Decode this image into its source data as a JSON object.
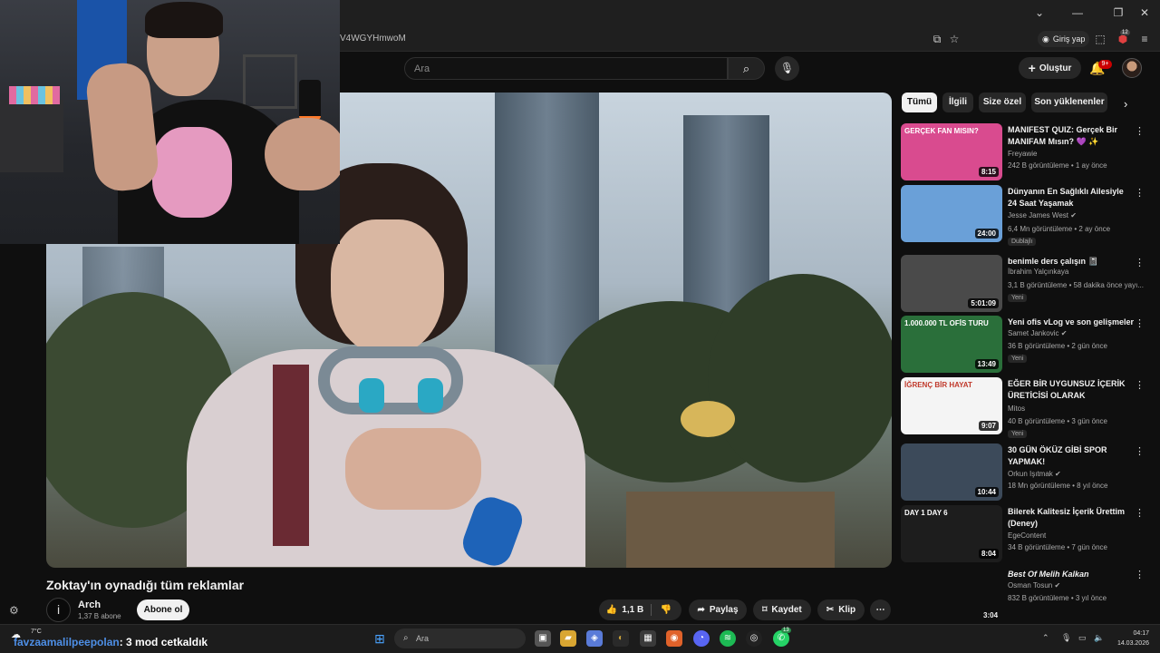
{
  "browser": {
    "url": "V4WGYHmwoM",
    "signin_label": "Giriş yap",
    "ext_badge": "12"
  },
  "youtube": {
    "search_placeholder": "Ara",
    "create_label": "Oluştur",
    "notif_badge": "9+"
  },
  "video": {
    "title": "Zoktay'ın oynadığı tüm reklamlar",
    "channel": "Arch",
    "subscribers": "1,37 B abone",
    "channel_initial": "i",
    "subscribe_label": "Abone ol",
    "likes": "1,1 B",
    "share_label": "Paylaş",
    "save_label": "Kaydet",
    "clip_label": "Klip"
  },
  "chips": [
    {
      "label": "Tümü",
      "active": true
    },
    {
      "label": "İlgili",
      "active": false
    },
    {
      "label": "Size özel",
      "active": false
    },
    {
      "label": "Son yüklenenler",
      "active": false
    }
  ],
  "recommendations": [
    {
      "title": "MANIFEST QUIZ: Gerçek Bir MANIFAM Mısın? 💜 ✨",
      "channel": "Freyawie",
      "meta": "242 B görüntüleme • 1 ay önce",
      "duration": "8:15",
      "badge": "",
      "verified": false,
      "thumb_text": "GERÇEK FAN MISIN?",
      "thumb_color": "#d94b8f"
    },
    {
      "title": "Dünyanın En Sağlıklı Ailesiyle 24 Saat Yaşamak",
      "channel": "Jesse James West",
      "meta": "6,4 Mn görüntüleme • 2 ay önce",
      "duration": "24:00",
      "badge": "Dublajlı",
      "verified": true,
      "thumb_text": "",
      "thumb_color": "#6aa0d8"
    },
    {
      "title": "benimle ders çalışın 📓",
      "channel": "İbrahim Yalçınkaya",
      "meta": "3,1 B görüntüleme • 58 dakika önce yayı...",
      "duration": "5:01:09",
      "badge": "Yeni",
      "verified": false,
      "thumb_text": "",
      "thumb_color": "#4a4a4a"
    },
    {
      "title": "Yeni ofis vLog ve son gelişmeler",
      "channel": "Samet Jankovic",
      "meta": "36 B görüntüleme • 2 gün önce",
      "duration": "13:49",
      "badge": "Yeni",
      "verified": true,
      "thumb_text": "1.000.000 TL OFİS TURU",
      "thumb_color": "#2a6f3a"
    },
    {
      "title": "EĞER BİR UYGUNSUZ İÇERİK ÜRETİCİSİ OLARAK DOĞSAYDI...",
      "channel": "Mitos",
      "meta": "40 B görüntüleme • 3 gün önce",
      "duration": "9:07",
      "badge": "Yeni",
      "verified": false,
      "thumb_text": "İĞRENÇ BİR HAYAT",
      "thumb_color": "#f4f4f4"
    },
    {
      "title": "30 GÜN ÖKÜZ GİBİ SPOR YAPMAK!",
      "channel": "Orkun Işıtmak",
      "meta": "18 Mn görüntüleme • 8 yıl önce",
      "duration": "10:44",
      "badge": "",
      "verified": true,
      "thumb_text": "",
      "thumb_color": "#3c4a5a"
    },
    {
      "title": "Bilerek Kalitesiz İçerik Ürettim (Deney)",
      "channel": "EgeContent",
      "meta": "34 B görüntüleme • 7 gün önce",
      "duration": "8:04",
      "badge": "",
      "verified": false,
      "thumb_text": "DAY 1 DAY 6",
      "thumb_color": "#1d1d1d"
    },
    {
      "title": "Best Of Melih Kalkan",
      "channel": "Osman Tosun",
      "meta": "832 B görüntüleme • 3 yıl önce",
      "duration": "3:04",
      "badge": "",
      "verified": true,
      "thumb_text": "",
      "thumb_color": "#0f0f0f"
    }
  ],
  "overlay": {
    "chat_user": "favzaamalilpeepolan",
    "chat_message": ": 3 mod cetkaldık"
  },
  "taskbar": {
    "temperature": "7°C",
    "search_placeholder": "Ara",
    "time": "04:17",
    "date": "14.03.2026",
    "whatsapp_badge": "13"
  }
}
